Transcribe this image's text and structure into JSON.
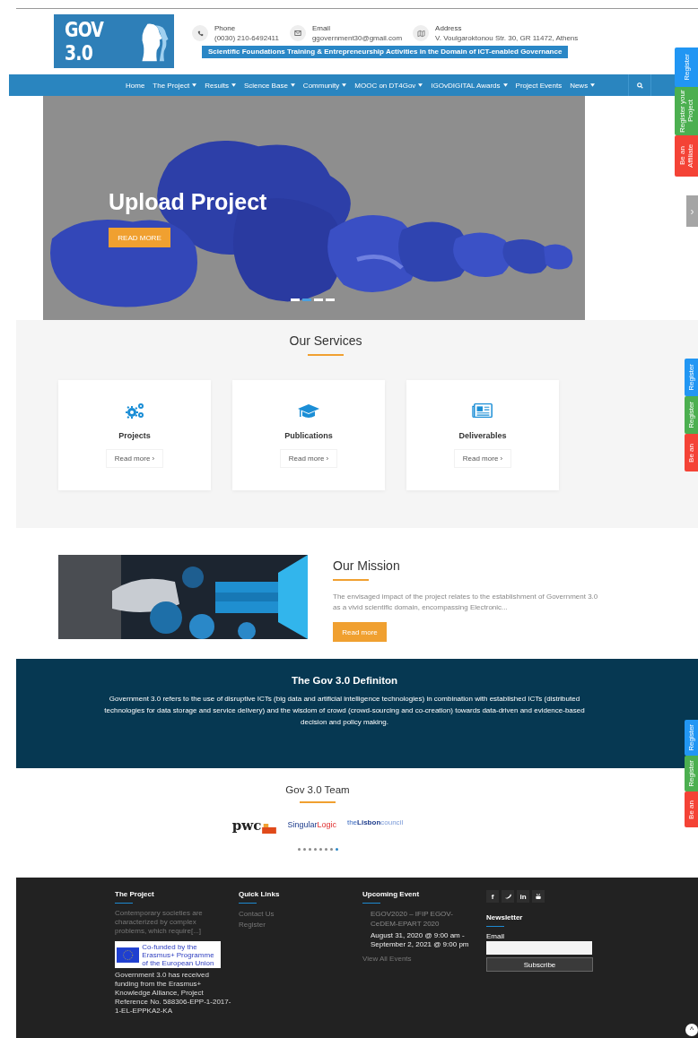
{
  "header": {
    "logo": "GOV 3.0",
    "contacts": [
      {
        "kind": "phone",
        "label": "Phone",
        "value": "(0030) 210-6492411"
      },
      {
        "kind": "email",
        "label": "Email",
        "value": "ggovernment30@gmail.com"
      },
      {
        "kind": "map",
        "label": "Address",
        "value": "V. Voulgaroktonou Str. 30, GR 11472, Athens"
      }
    ],
    "banner": "Scientific Foundations Training & Entrepreneurship Activities in the Domain of ICT-enabled Governance"
  },
  "nav": {
    "items": [
      {
        "label": "Home",
        "dropdown": false
      },
      {
        "label": "The Project",
        "dropdown": true
      },
      {
        "label": "Results",
        "dropdown": true
      },
      {
        "label": "Science Base",
        "dropdown": true
      },
      {
        "label": "Community",
        "dropdown": true
      },
      {
        "label": "MOOC on DT4Gov",
        "dropdown": true
      },
      {
        "label": "IGOvDIGITAL Awards",
        "dropdown": true
      },
      {
        "label": "Project Events",
        "dropdown": false
      },
      {
        "label": "News",
        "dropdown": true
      }
    ]
  },
  "hero": {
    "title": "Upload Project",
    "button": "READ MORE",
    "dots": [
      {
        "selected": false
      },
      {
        "selected": true
      },
      {
        "selected": false
      },
      {
        "selected": false
      }
    ]
  },
  "side_tabs": [
    [
      {
        "label": "Register",
        "color": "#2196f3"
      },
      {
        "label": "Register your Project",
        "color": "#4caf50"
      },
      {
        "label": "Be an Affiliate",
        "color": "#f44336"
      }
    ],
    [
      {
        "label": "Register",
        "color": "#2196f3"
      },
      {
        "label": "Register",
        "color": "#4caf50"
      },
      {
        "label": "Be an",
        "color": "#f44336"
      }
    ],
    [
      {
        "label": "Register",
        "color": "#2196f3"
      },
      {
        "label": "Register",
        "color": "#4caf50"
      },
      {
        "label": "Be an",
        "color": "#f44336"
      }
    ]
  ],
  "slider_next": "›",
  "services": {
    "title": "Our Services",
    "cards": [
      {
        "kind": "gears",
        "title": "Projects",
        "link": "Read more ›"
      },
      {
        "kind": "cap",
        "title": "Publications",
        "link": "Read more ›"
      },
      {
        "kind": "news",
        "title": "Deliverables",
        "link": "Read more ›"
      }
    ]
  },
  "mission": {
    "title": "Our Mission",
    "text": "The envisaged impact of the project relates to the establishment of Government 3.0 as a vivid scientific domain, encompassing Electronic...",
    "button": "Read more"
  },
  "definition": {
    "title": "The Gov 3.0 Definiton",
    "text": "Government 3.0 refers to the use of disruptive ICTs (big data and artificial intelligence technologies) in combination with established ICTs (distributed technologies for data storage and service delivery) and the wisdom of crowd (crowd-sourcing and co-creation) towards data-driven and evidence-based decision and policy making."
  },
  "team": {
    "title": "Gov 3.0 Team",
    "logos": [
      {
        "kind": "pwc",
        "label": "pwc"
      },
      {
        "kind": "singular",
        "label": "Singular",
        "label2": "Logic"
      },
      {
        "kind": "lisbon",
        "label": "the",
        "label2": "Lisbon",
        "label3": "council"
      }
    ],
    "dots": [
      {
        "selected": false
      },
      {
        "selected": false
      },
      {
        "selected": false
      },
      {
        "selected": false
      },
      {
        "selected": false
      },
      {
        "selected": false
      },
      {
        "selected": false
      },
      {
        "selected": true
      }
    ]
  },
  "footer": {
    "project": {
      "title": "The Project",
      "text": "Contemporary societies are characterized by complex problems, which require[...]",
      "eu": "Co-funded by the Erasmus+ Programme of the European Union",
      "funding": "Government 3.0 has received funding from the Erasmus+ Knowledge Alliance, Project Reference No. 588306-EPP-1-2017-1-EL-EPPKA2-KA"
    },
    "links": {
      "title": "Quick Links",
      "items": [
        "Contact Us",
        "Register"
      ]
    },
    "event": {
      "title": "Upcoming Event",
      "name": "EGOV2020 – IFIP EGOV-CeDEM-EPART 2020",
      "date": "August 31, 2020 @ 9:00 am - September 2, 2021 @ 9:00 pm",
      "all": "View All Events"
    },
    "social": [
      {
        "kind": "text",
        "label": "f"
      },
      {
        "kind": "bird"
      },
      {
        "kind": "text",
        "label": "in"
      },
      {
        "kind": "tube"
      }
    ],
    "newsletter": {
      "title": "Newsletter",
      "label": "Email",
      "button": "Subscribe"
    }
  },
  "to_top": "^"
}
